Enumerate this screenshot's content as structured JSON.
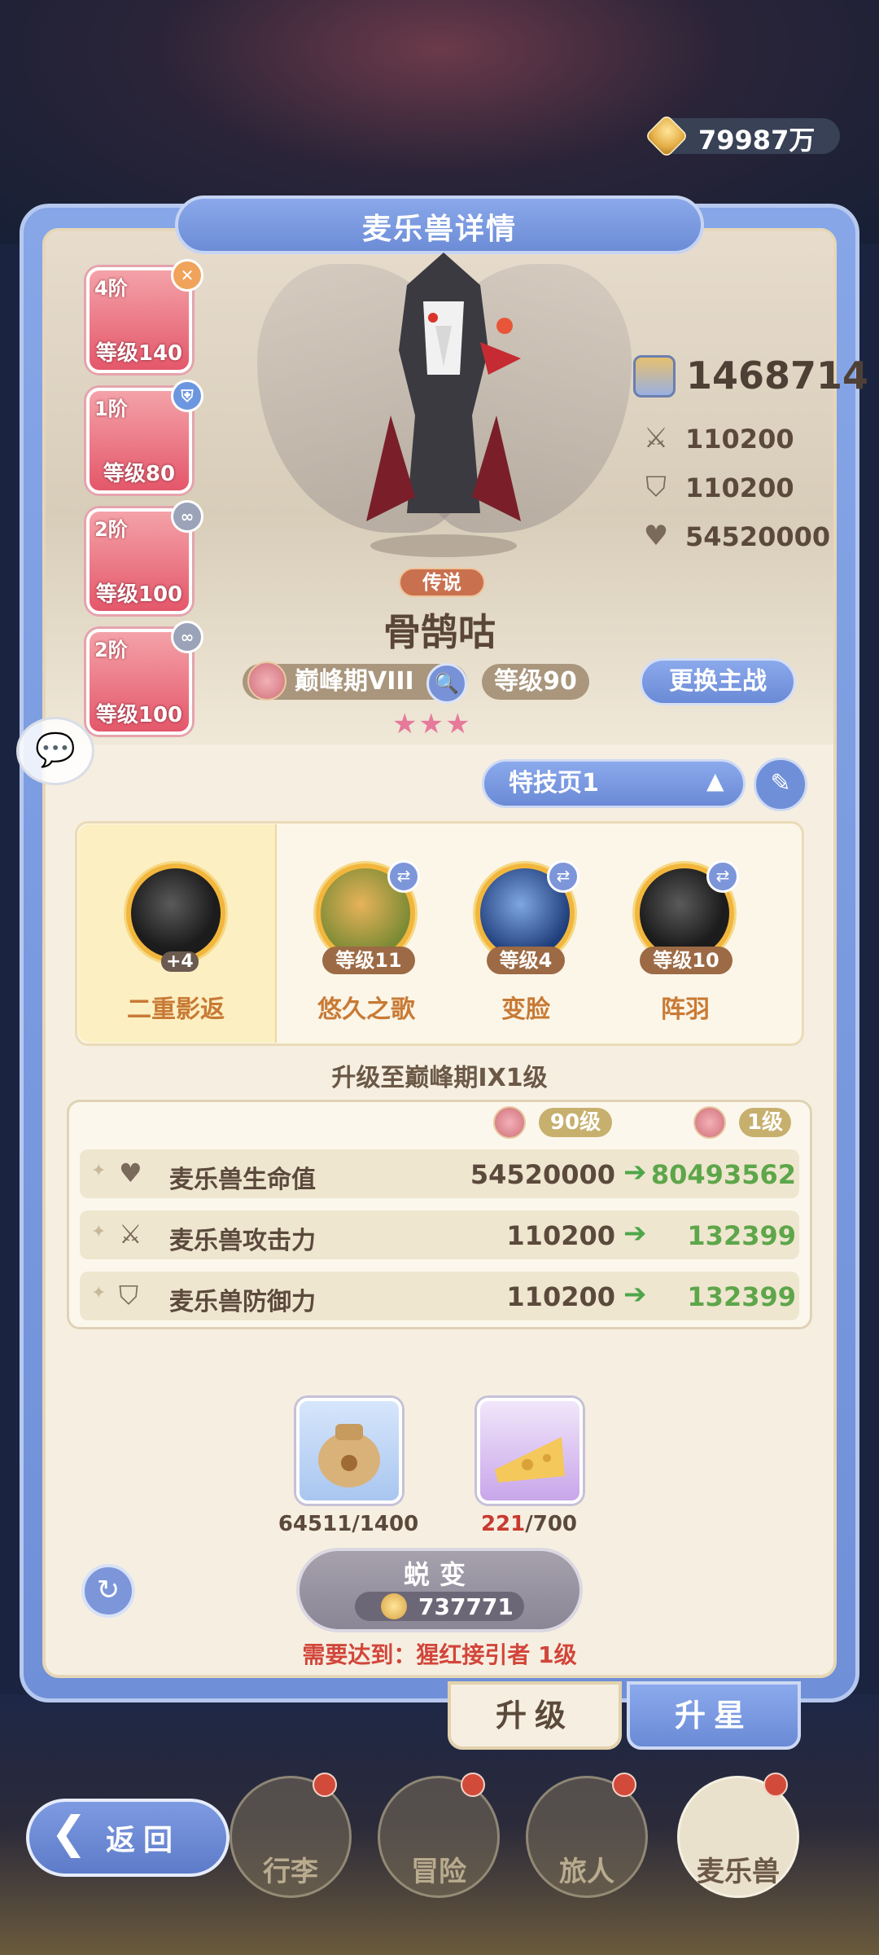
{
  "currency": {
    "amount": "79987万"
  },
  "panel": {
    "title": "麦乐兽详情"
  },
  "team": [
    {
      "stage": "4阶",
      "level": "等级140",
      "badge": "✕",
      "badge_color": "#f0a35a"
    },
    {
      "stage": "1阶",
      "level": "等级80",
      "badge": "⛨",
      "badge_color": "#6d96e0"
    },
    {
      "stage": "2阶",
      "level": "等级100",
      "badge": "∞",
      "badge_color": "#9aa3b8"
    },
    {
      "stage": "2阶",
      "level": "等级100",
      "badge": "∞",
      "badge_color": "#9aa3b8"
    }
  ],
  "creature": {
    "rarity": "传说",
    "name": "骨鹄咕",
    "stage": "巅峰期VIII",
    "level": "等级90",
    "stars": "★★★",
    "change_button": "更换主战"
  },
  "stats": {
    "power": "1468714",
    "attack": "110200",
    "defense": "110200",
    "hp": "54520000"
  },
  "skill_page": {
    "label": "特技页1"
  },
  "skills": [
    {
      "name": "二重影返",
      "level": "+4"
    },
    {
      "name": "悠久之歌",
      "level": "等级11"
    },
    {
      "name": "变脸",
      "level": "等级4"
    },
    {
      "name": "阵羽",
      "level": "等级10"
    }
  ],
  "upgrade": {
    "title": "升级至巅峰期IX1级",
    "from_level": "90级",
    "to_level": "1级",
    "rows": [
      {
        "label": "麦乐兽生命值",
        "from": "54520000",
        "to": "80493562"
      },
      {
        "label": "麦乐兽攻击力",
        "from": "110200",
        "to": "132399"
      },
      {
        "label": "麦乐兽防御力",
        "from": "110200",
        "to": "132399"
      }
    ]
  },
  "materials": [
    {
      "have": "64511",
      "need": "/1400"
    },
    {
      "have": "221",
      "need": "/700"
    }
  ],
  "evolve": {
    "label": "蜕变",
    "cost": "737771",
    "requirement": "需要达到：猩红接引者 1级"
  },
  "tabs": {
    "upgrade": "升级",
    "star": "升星"
  },
  "nav": {
    "back": "返回",
    "items": [
      "行李",
      "冒险",
      "旅人",
      "麦乐兽"
    ]
  }
}
